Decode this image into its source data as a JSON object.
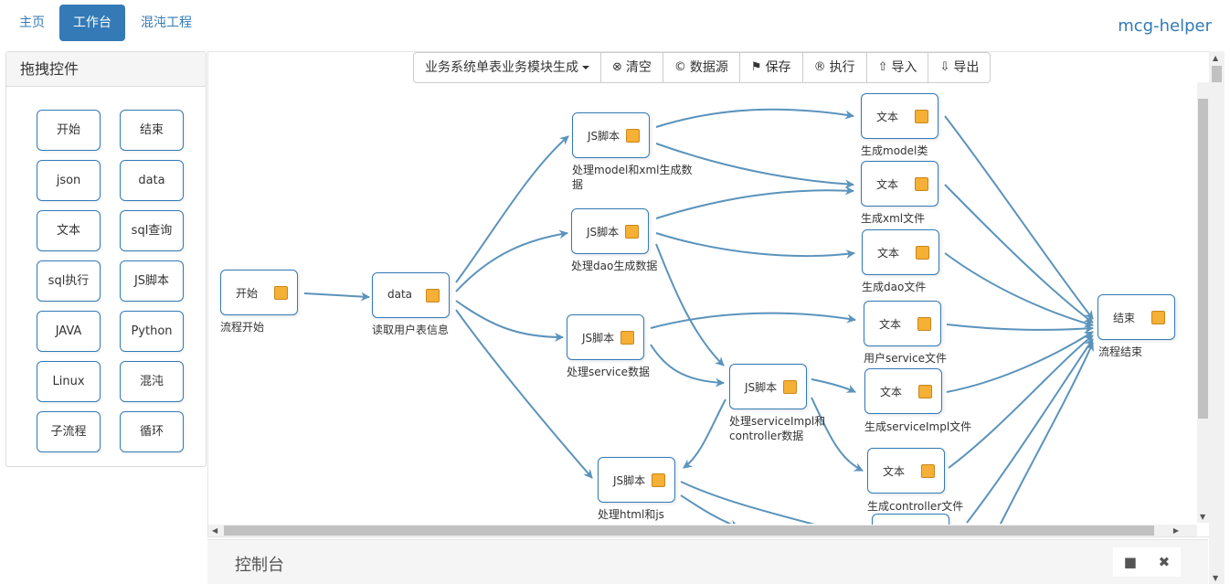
{
  "nav": {
    "items": [
      "主页",
      "工作台",
      "混沌工程"
    ],
    "brand": "mcg-helper"
  },
  "controls_panel": {
    "title": "拖拽控件",
    "items": [
      "开始",
      "结束",
      "json",
      "data",
      "文本",
      "sql查询",
      "sql执行",
      "JS脚本",
      "JAVA",
      "Python",
      "Linux",
      "混沌",
      "子流程",
      "循环"
    ]
  },
  "toolbar": {
    "flow_select": "业务系统单表业务模块生成",
    "clear": "清空",
    "datasource": "数据源",
    "save": "保存",
    "execute": "执行",
    "import": "导入",
    "export": "导出"
  },
  "flow": {
    "nodes": [
      {
        "id": "start",
        "type": "开始",
        "caption": "流程开始"
      },
      {
        "id": "data",
        "type": "data",
        "caption": "读取用户表信息"
      },
      {
        "id": "js_model",
        "type": "JS脚本",
        "caption": "处理model和xml生成数\n据"
      },
      {
        "id": "js_dao",
        "type": "JS脚本",
        "caption": "处理dao生成数据"
      },
      {
        "id": "js_service",
        "type": "JS脚本",
        "caption": "处理service数据"
      },
      {
        "id": "js_impl",
        "type": "JS脚本",
        "caption": "处理serviceImpl和\ncontroller数据"
      },
      {
        "id": "js_html",
        "type": "JS脚本",
        "caption": "处理html和js"
      },
      {
        "id": "t_model",
        "type": "文本",
        "caption": "生成model类"
      },
      {
        "id": "t_xml",
        "type": "文本",
        "caption": "生成xml文件"
      },
      {
        "id": "t_dao",
        "type": "文本",
        "caption": "生成dao文件"
      },
      {
        "id": "t_service",
        "type": "文本",
        "caption": "用户service文件"
      },
      {
        "id": "t_impl",
        "type": "文本",
        "caption": "生成serviceImpl文件"
      },
      {
        "id": "t_controller",
        "type": "文本",
        "caption": "生成controller文件"
      },
      {
        "id": "t_partial",
        "type": "文本",
        "caption": ""
      },
      {
        "id": "end",
        "type": "结束",
        "caption": "流程结束"
      }
    ]
  },
  "console": {
    "title": "控制台",
    "stop_icon": "■",
    "close_icon": "✖"
  },
  "colors": {
    "primary": "#337ab7",
    "link": "#5b93bb",
    "handle": "#f5b035"
  }
}
